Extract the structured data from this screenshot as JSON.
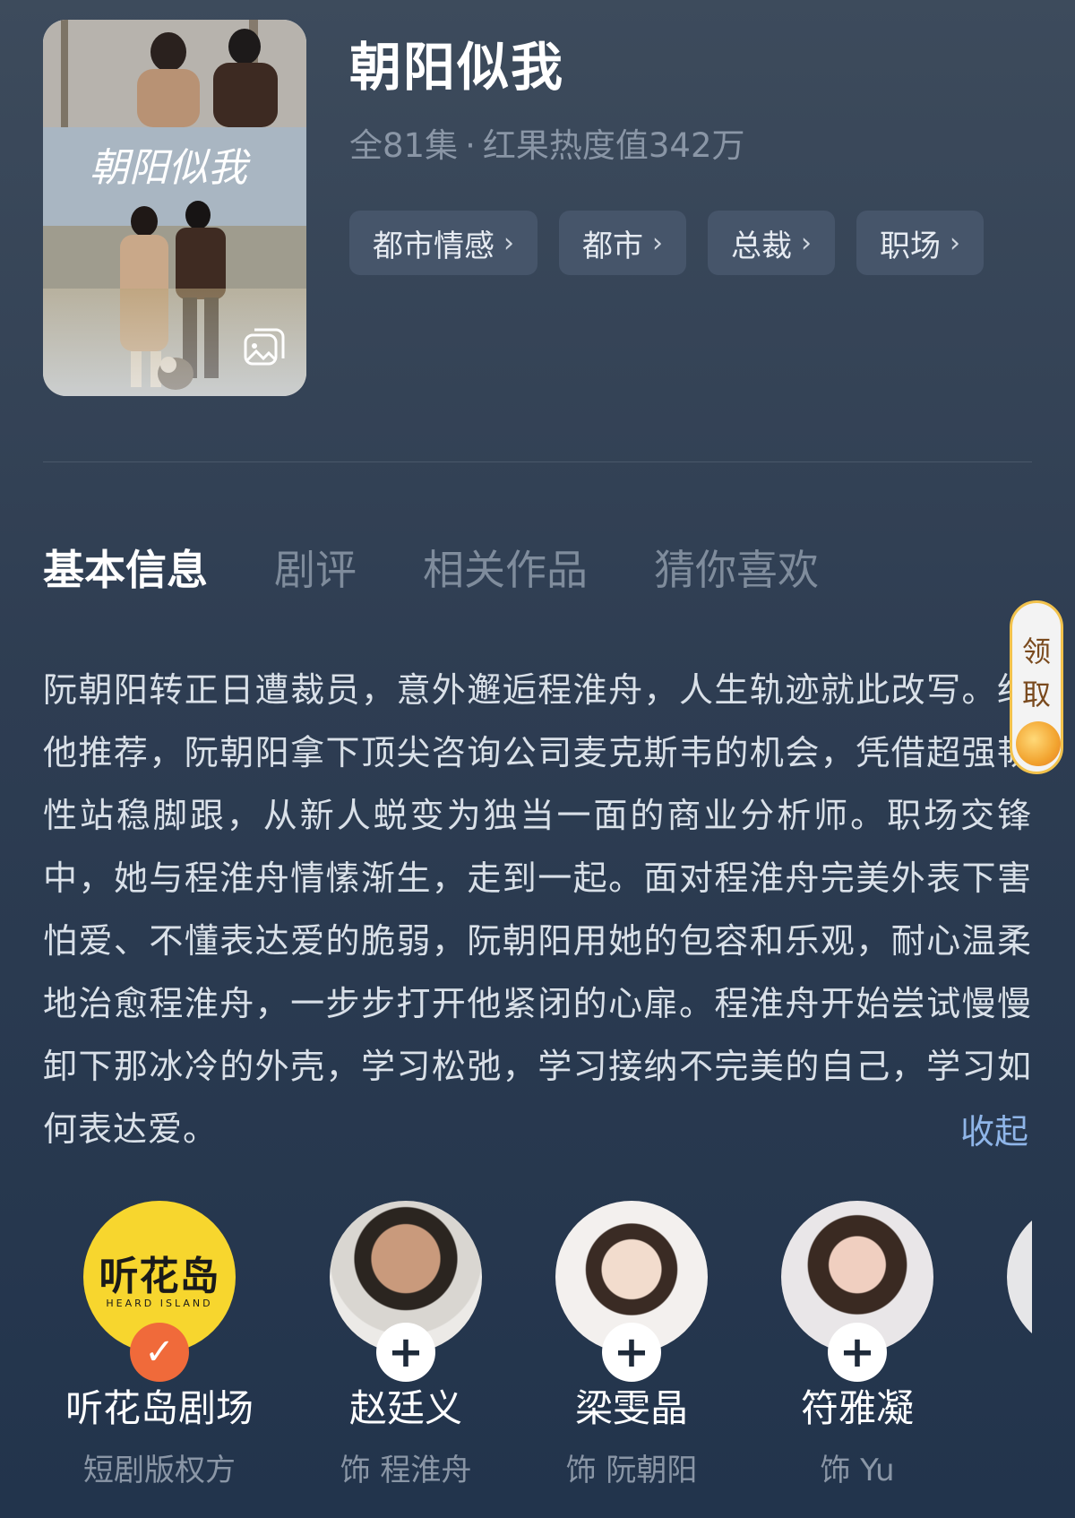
{
  "show": {
    "title": "朝阳似我",
    "episodes": "全81集",
    "separator": "·",
    "heat": "红果热度值342万",
    "poster_text": "朝阳似我"
  },
  "tags": [
    {
      "label": "都市情感"
    },
    {
      "label": "都市"
    },
    {
      "label": "总裁"
    },
    {
      "label": "职场"
    }
  ],
  "tabs": [
    {
      "label": "基本信息",
      "active": true
    },
    {
      "label": "剧评",
      "active": false
    },
    {
      "label": "相关作品",
      "active": false
    },
    {
      "label": "猜你喜欢",
      "active": false
    }
  ],
  "synopsis": {
    "text": "阮朝阳转正日遭裁员，意外邂逅程淮舟，人生轨迹就此改写。经他推荐，阮朝阳拿下顶尖咨询公司麦克斯韦的机会，凭借超强韧性站稳脚跟，从新人蜕变为独当一面的商业分析师。职场交锋中，她与程淮舟情愫渐生，走到一起。面对程淮舟完美外表下害怕爱、不懂表达爱的脆弱，阮朝阳用她的包容和乐观，耐心温柔地治愈程淮舟，一步步打开他紧闭的心扉。程淮舟开始尝试慢慢卸下那冰冷的外壳，学习松弛，学习接纳不完美的自己，学习如何表达爱。",
    "collapse_label": "收起"
  },
  "reward_float": {
    "line1": "领",
    "line2": "取"
  },
  "people": [
    {
      "name": "听花岛剧场",
      "role": "短剧版权方",
      "logo_text": "听花岛",
      "logo_sub": "HEARD ISLAND",
      "badge": "✓"
    },
    {
      "name": "赵廷义",
      "role": "饰 程淮舟",
      "badge": "+"
    },
    {
      "name": "梁雯晶",
      "role": "饰 阮朝阳",
      "badge": "+"
    },
    {
      "name": "符雅凝",
      "role": "饰 Yu",
      "badge": "+"
    }
  ],
  "icons": {
    "chevron": "chevron-right-icon",
    "gallery": "gallery-icon",
    "check": "check-icon",
    "plus": "plus-icon"
  },
  "colors": {
    "accent_link": "#8fb5e8",
    "follow_badge": "#f06a3a",
    "logo_yellow": "#f7d62e"
  }
}
